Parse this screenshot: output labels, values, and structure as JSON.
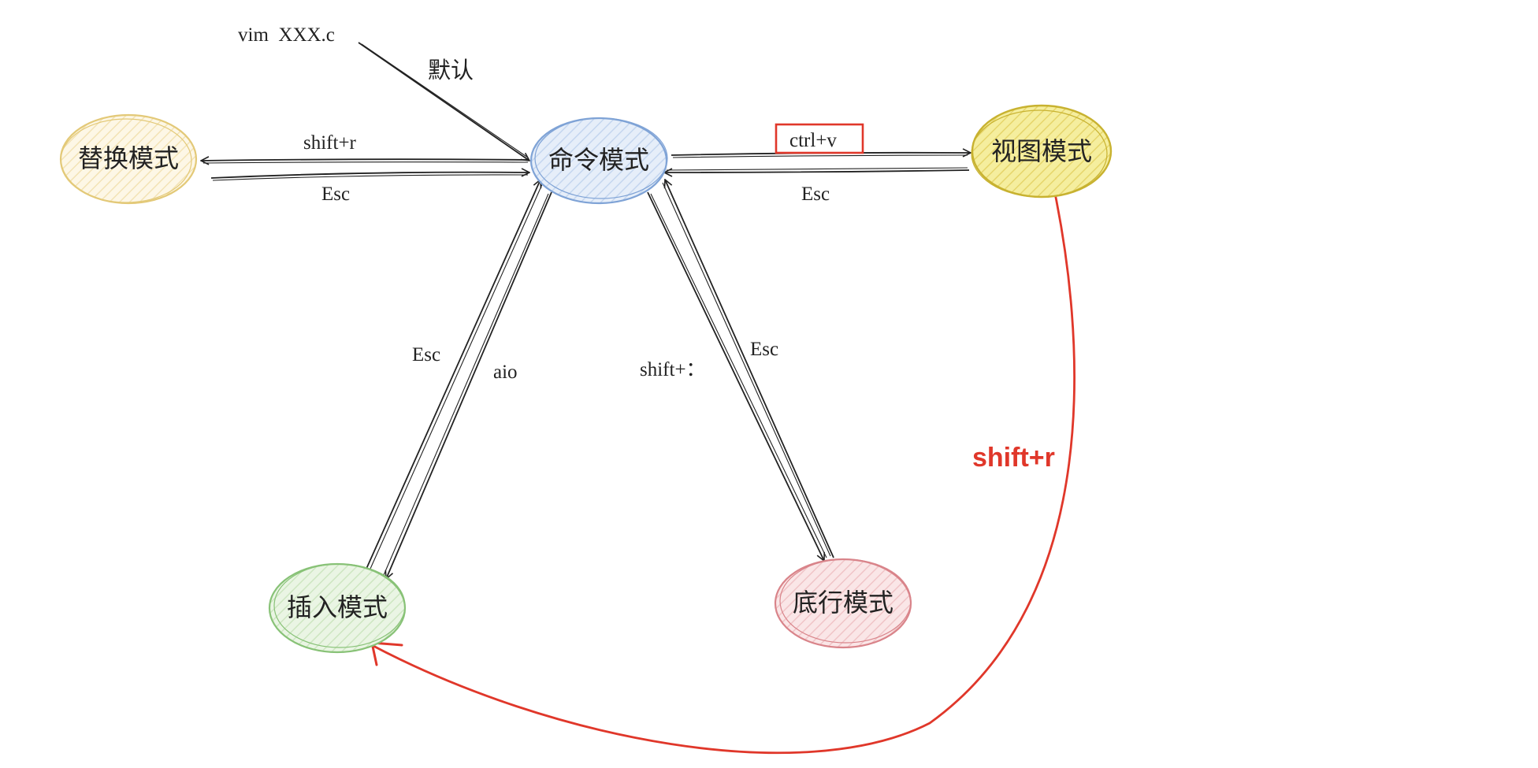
{
  "nodes": {
    "command": "命令模式",
    "replace": "替换模式",
    "view": "视图模式",
    "insert": "插入模式",
    "lastline": "底行模式"
  },
  "edges": {
    "start_text": "vim  XXX.c",
    "default": "默认",
    "to_replace": "shift+r",
    "from_replace": "Esc",
    "to_view": "ctrl+v",
    "from_view": "Esc",
    "from_insert": "Esc",
    "to_insert": "aio",
    "to_lastline": "shift+：",
    "from_lastline": "Esc",
    "view_to_insert": "shift+r"
  },
  "colors": {
    "command_stroke": "#7fa3d6",
    "command_fill": "#dfe9f7",
    "replace_stroke": "#e3c978",
    "replace_fill": "#fcf3d9",
    "view_stroke": "#c8b230",
    "view_fill": "#f2e89a",
    "insert_stroke": "#88c277",
    "insert_fill": "#e3f2dc",
    "lastline_stroke": "#d9848a",
    "lastline_fill": "#f8dfe0",
    "highlight": "#e0372a"
  }
}
